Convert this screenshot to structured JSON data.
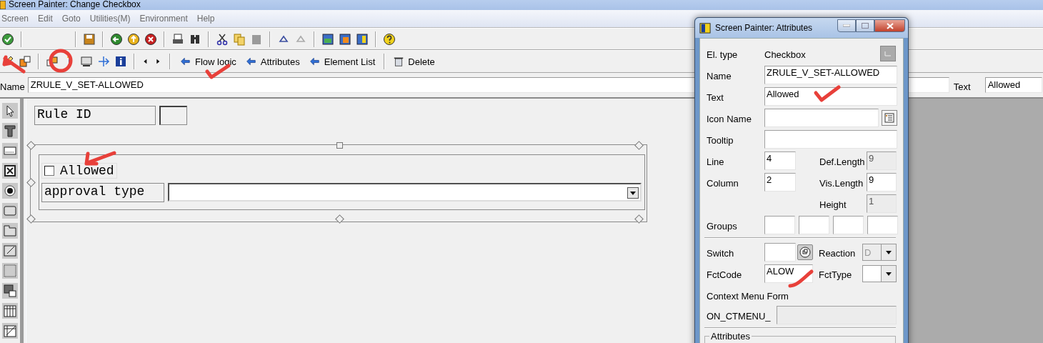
{
  "window": {
    "title": "Screen Painter:  Change Checkbox"
  },
  "menu": [
    {
      "label": "Screen"
    },
    {
      "label": "Edit"
    },
    {
      "label": "Goto"
    },
    {
      "label": "Utilities(M)"
    },
    {
      "label": "Environment"
    },
    {
      "label": "Help"
    }
  ],
  "app_toolbar": [
    {
      "label": "Flow logic"
    },
    {
      "label": "Attributes"
    },
    {
      "label": "Element List"
    },
    {
      "label": "Delete"
    }
  ],
  "name_row": {
    "label": "Name",
    "value": "ZRULE_V_SET-ALLOWED",
    "text_label": "Text",
    "text_value": "Allowed"
  },
  "canvas": {
    "rule_id": {
      "label": "Rule ID"
    },
    "checkbox": {
      "label": "Allowed",
      "checked": false
    },
    "dropdown_label": {
      "label": "approval type"
    }
  },
  "dialog": {
    "title": "Screen Painter: Attributes",
    "el_type": {
      "label": "El. type",
      "value": "Checkbox"
    },
    "name": {
      "label": "Name",
      "value": "ZRULE_V_SET-ALLOWED"
    },
    "text": {
      "label": "Text",
      "value": "Allowed"
    },
    "icon_name": {
      "label": "Icon Name"
    },
    "tooltip": {
      "label": "Tooltip"
    },
    "line": {
      "label": "Line",
      "value": "4"
    },
    "def_length": {
      "label": "Def.Length",
      "value": "9",
      "disabled": true
    },
    "column": {
      "label": "Column",
      "value": "2"
    },
    "vis_length": {
      "label": "Vis.Length",
      "value": "9",
      "disabled": false
    },
    "height": {
      "label": "Height",
      "value": "1",
      "disabled": true
    },
    "groups": {
      "label": "Groups"
    },
    "switch": {
      "label": "Switch"
    },
    "reaction": {
      "label": "Reaction",
      "value": "D",
      "disabled": true
    },
    "fct_code": {
      "label": "FctCode",
      "value": "ALOW"
    },
    "fct_type": {
      "label": "FctType",
      "disabled": false
    },
    "context_menu": {
      "label": "Context Menu Form",
      "prefix": "ON_CTMENU_",
      "disabled": true
    },
    "attributes_group": {
      "label": "Attributes"
    }
  }
}
